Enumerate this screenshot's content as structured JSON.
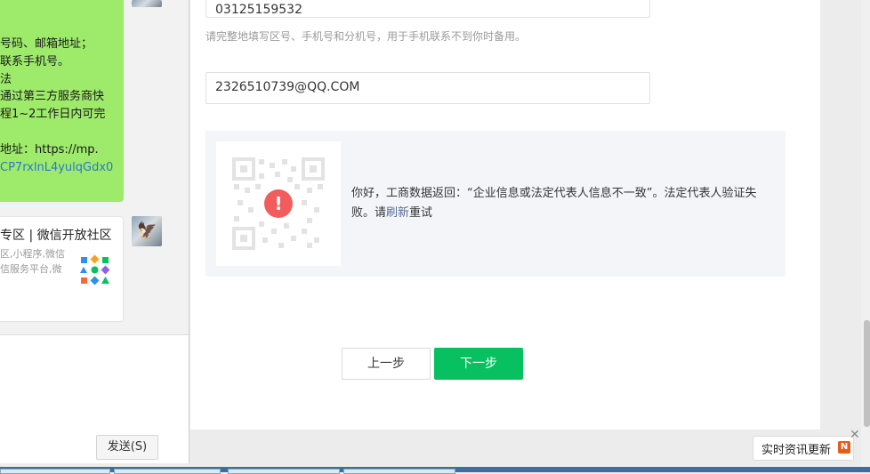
{
  "chat": {
    "bubble_lines": [
      "号码、邮箱地址；",
      "联系手机号。",
      "法",
      "通过第三方服务商快",
      "程1~2工作日内可完",
      "",
      "地址：https://mp.",
      "CP7rxlnL4yulqGdx0"
    ],
    "card": {
      "title": "专区 | 微信开放社区",
      "desc_line1": "区,小程序,微信",
      "desc_line2": "信服务平台,微"
    },
    "send_label": "发送(S)"
  },
  "form": {
    "phone_value": "03125159532",
    "phone_hint": "请完整地填写区号、手机号和分机号，用于手机联系不到你时备用。",
    "email_value": "2326510739@QQ.COM",
    "notice_text_before": "你好，工商数据返回：“企业信息或法定代表人信息不一致”。法定代表人验证失败。请",
    "notice_refresh_link": "刷新",
    "notice_text_after": "重试",
    "error_icon_char": "!",
    "prev_label": "上一步",
    "next_label": "下一步"
  },
  "toast": {
    "text": "实时资讯更新",
    "badge": "N",
    "close": "✕"
  },
  "colors": {
    "bubble": "#9eea6a",
    "primary": "#07c160",
    "error": "#f25c5c",
    "link": "#576b95"
  }
}
